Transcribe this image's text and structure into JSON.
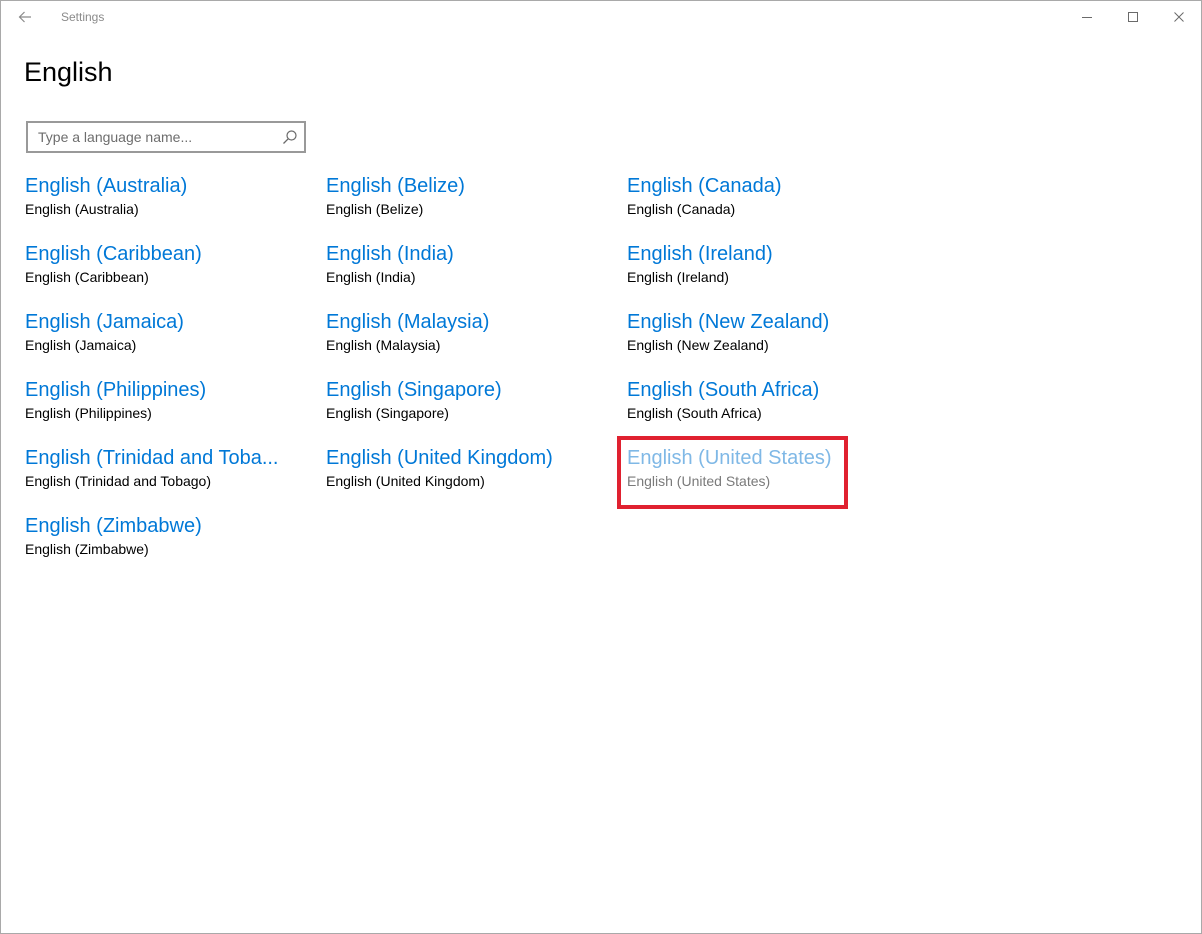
{
  "window": {
    "title": "Settings"
  },
  "page": {
    "title": "English"
  },
  "search": {
    "placeholder": "Type a language name...",
    "value": ""
  },
  "languages": [
    {
      "name": "English (Australia)",
      "native": "English (Australia)"
    },
    {
      "name": "English (Belize)",
      "native": "English (Belize)"
    },
    {
      "name": "English (Canada)",
      "native": "English (Canada)"
    },
    {
      "name": "English (Caribbean)",
      "native": "English (Caribbean)"
    },
    {
      "name": "English (India)",
      "native": "English (India)"
    },
    {
      "name": "English (Ireland)",
      "native": "English (Ireland)"
    },
    {
      "name": "English (Jamaica)",
      "native": "English (Jamaica)"
    },
    {
      "name": "English (Malaysia)",
      "native": "English (Malaysia)"
    },
    {
      "name": "English (New Zealand)",
      "native": "English (New Zealand)"
    },
    {
      "name": "English (Philippines)",
      "native": "English (Philippines)"
    },
    {
      "name": "English (Singapore)",
      "native": "English (Singapore)"
    },
    {
      "name": "English (South Africa)",
      "native": "English (South Africa)"
    },
    {
      "name": "English (Trinidad and Toba...",
      "native": "English (Trinidad and Tobago)"
    },
    {
      "name": "English (United Kingdom)",
      "native": "English (United Kingdom)"
    },
    {
      "name": "English (United States)",
      "native": "English (United States)",
      "installed": true
    },
    {
      "name": "English (Zimbabwe)",
      "native": "English (Zimbabwe)"
    }
  ],
  "colors": {
    "accent": "#0078d7",
    "accent_disabled": "#7fb8e6",
    "highlight": "#e02130"
  },
  "icons": {
    "back": "back-arrow-icon",
    "search": "search-icon",
    "minimize": "minimize-icon",
    "maximize": "maximize-icon",
    "close": "close-icon"
  }
}
